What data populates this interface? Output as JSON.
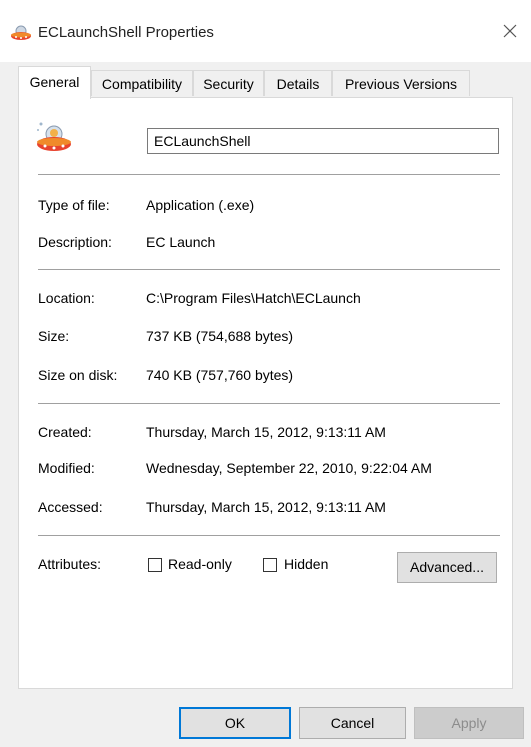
{
  "window": {
    "title": "ECLaunchShell Properties",
    "icon": "ufo-icon"
  },
  "tabs": [
    {
      "label": "General",
      "active": true
    },
    {
      "label": "Compatibility",
      "active": false
    },
    {
      "label": "Security",
      "active": false
    },
    {
      "label": "Details",
      "active": false
    },
    {
      "label": "Previous Versions",
      "active": false
    }
  ],
  "general": {
    "file_name": "ECLaunchShell",
    "type_label": "Type of file:",
    "type_value": "Application (.exe)",
    "description_label": "Description:",
    "description_value": "EC Launch",
    "location_label": "Location:",
    "location_value": "C:\\Program Files\\Hatch\\ECLaunch",
    "size_label": "Size:",
    "size_value": "737 KB (754,688 bytes)",
    "size_on_disk_label": "Size on disk:",
    "size_on_disk_value": "740 KB (757,760 bytes)",
    "created_label": "Created:",
    "created_value": "Thursday, March 15, 2012, 9:13:11 AM",
    "modified_label": "Modified:",
    "modified_value": "Wednesday, September 22, 2010, 9:22:04 AM",
    "accessed_label": "Accessed:",
    "accessed_value": "Thursday, March 15, 2012, 9:13:11 AM",
    "attributes_label": "Attributes:",
    "readonly_label": "Read-only",
    "readonly_checked": false,
    "hidden_label": "Hidden",
    "hidden_checked": false,
    "advanced_label": "Advanced..."
  },
  "buttons": {
    "ok": "OK",
    "cancel": "Cancel",
    "apply": "Apply"
  },
  "colors": {
    "accent": "#0078d7",
    "icon_red": "#e8432e",
    "icon_orange": "#f08a2a"
  }
}
